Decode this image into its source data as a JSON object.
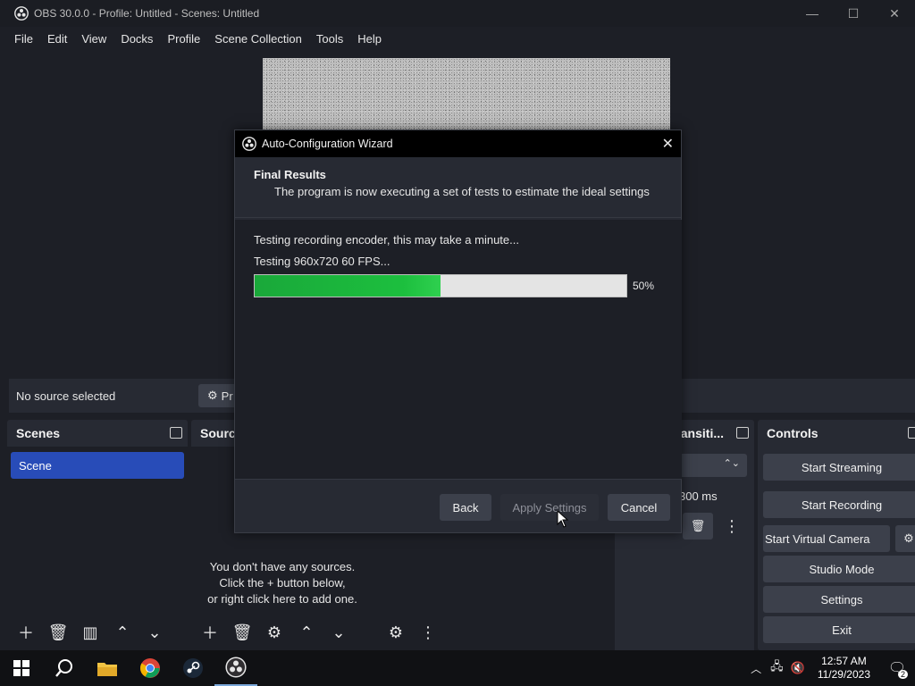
{
  "window": {
    "title": "OBS 30.0.0 - Profile: Untitled - Scenes: Untitled",
    "controls": {
      "minimize": "—",
      "maximize": "☐",
      "close": "✕"
    }
  },
  "menu": [
    "File",
    "Edit",
    "View",
    "Docks",
    "Profile",
    "Scene Collection",
    "Tools",
    "Help"
  ],
  "context_bar": {
    "no_source": "No source selected",
    "properties_label": "Pr"
  },
  "scenes": {
    "title": "Scenes",
    "items": [
      "Scene"
    ]
  },
  "sources": {
    "title": "Sourc",
    "empty_lines": [
      "You don't have any sources.",
      "Click the + button below,",
      "or right click here to add one."
    ]
  },
  "transitions": {
    "title": "ansiti...",
    "duration": "300 ms"
  },
  "controls": {
    "title": "Controls",
    "buttons": [
      "Start Streaming",
      "Start Recording",
      "Start Virtual Camera",
      "Studio Mode",
      "Settings",
      "Exit"
    ]
  },
  "dialog": {
    "title": "Auto-Configuration Wizard",
    "heading": "Final Results",
    "subheading": "The program is now executing a set of tests to estimate the ideal settings",
    "status_line1": "Testing recording encoder, this may take a minute...",
    "status_line2": "Testing 960x720 60 FPS...",
    "progress": 0.5,
    "progress_label": "50%",
    "buttons": {
      "back": "Back",
      "apply": "Apply Settings",
      "cancel": "Cancel"
    }
  },
  "taskbar": {
    "time": "12:57 AM",
    "date": "11/29/2023",
    "notification_count": "2"
  },
  "colors": {
    "accent": "#284cb8",
    "progress_fill": "#1cbf3e",
    "background": "#1d1f26",
    "panel": "#272a33"
  }
}
